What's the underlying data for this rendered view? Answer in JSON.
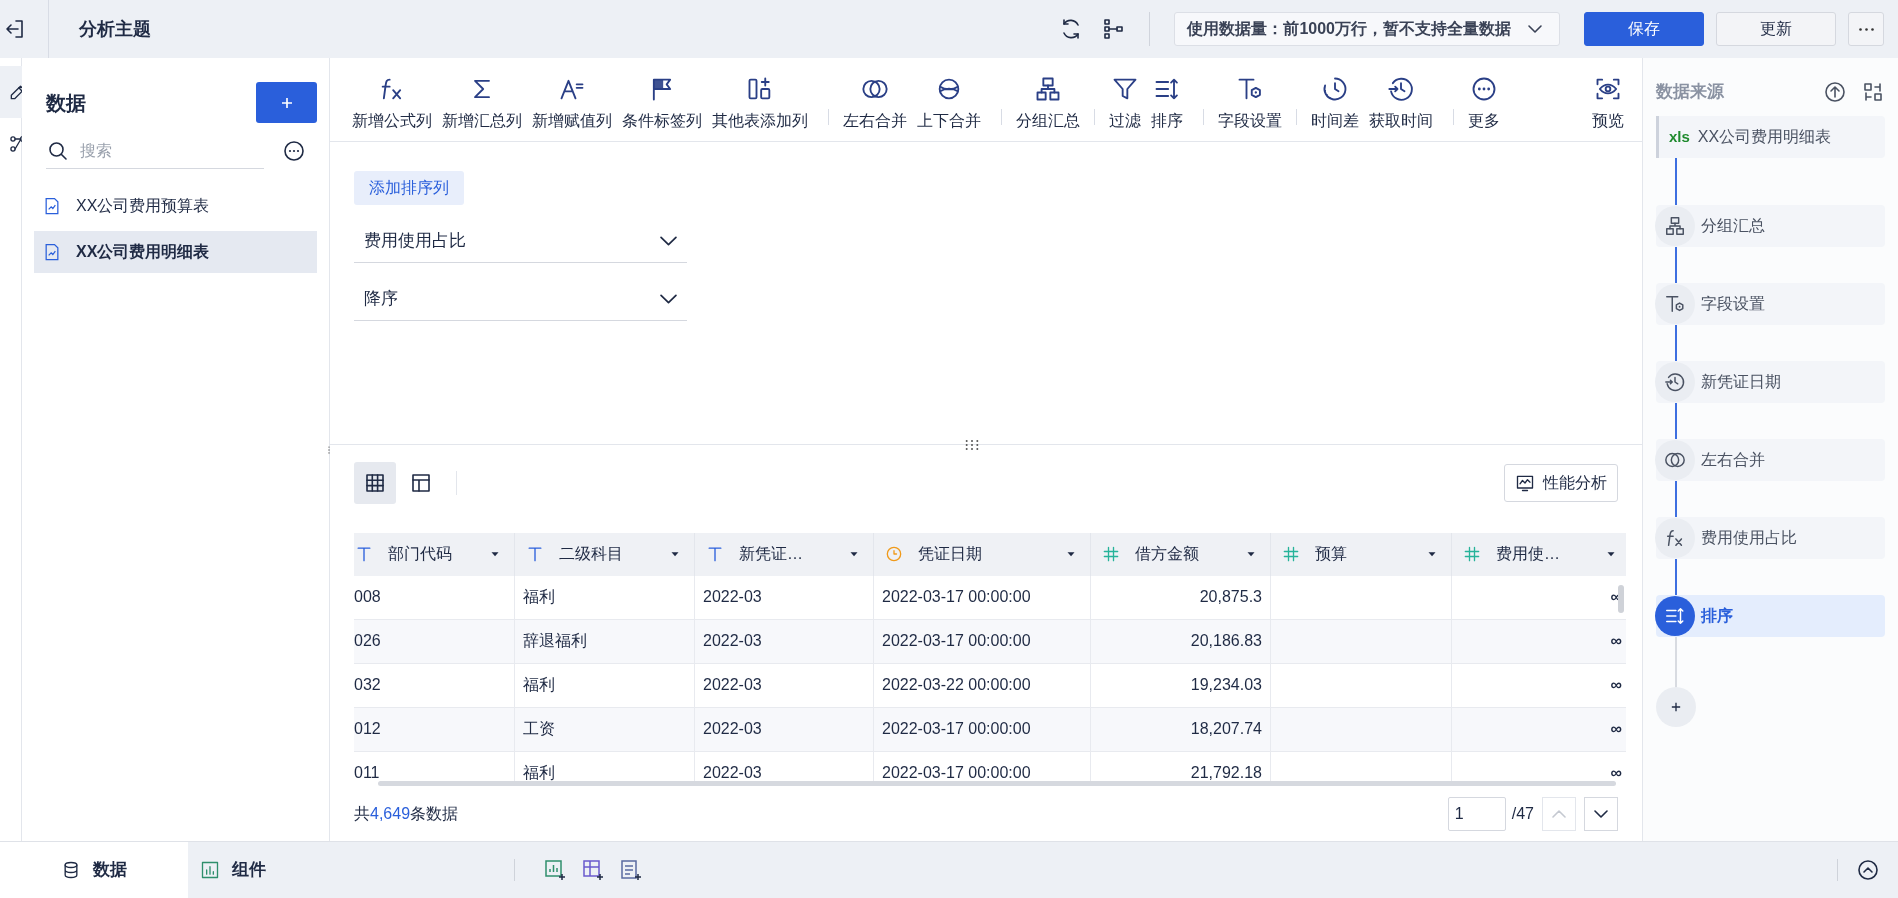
{
  "top_bar": {
    "title": "分析主题",
    "data_limit": "使用数据量：前1000万行，暂不支持全量数据",
    "buttons": [
      {
        "label": "保存",
        "kind": "primary"
      },
      {
        "label": "更新",
        "kind": "secondary"
      }
    ]
  },
  "side_rail": [
    {
      "kind": "edit",
      "selected": true
    },
    {
      "kind": "flow",
      "selected": false
    }
  ],
  "data_panel": {
    "title": "数据",
    "search": {
      "placeholder": "搜索"
    },
    "items": [
      {
        "label": "XX公司费用预算表",
        "selected": false
      },
      {
        "label": "XX公司费用明细表",
        "selected": true
      }
    ]
  },
  "toolbar": [
    [
      {
        "label": "新增公式列",
        "kind": "formula"
      },
      {
        "label": "新增汇总列",
        "kind": "sum"
      },
      {
        "label": "新增赋值列",
        "kind": "assign"
      },
      {
        "label": "条件标签列",
        "kind": "flag"
      },
      {
        "label": "其他表添加列",
        "kind": "addcol"
      }
    ],
    [
      {
        "label": "左右合并",
        "kind": "merge_lr"
      },
      {
        "label": "上下合并",
        "kind": "merge_ud"
      }
    ],
    [
      {
        "label": "分组汇总",
        "kind": "group"
      }
    ],
    [
      {
        "label": "过滤",
        "kind": "filter"
      },
      {
        "label": "排序",
        "kind": "sort"
      }
    ],
    [
      {
        "label": "字段设置",
        "kind": "field"
      }
    ],
    [
      {
        "label": "时间差",
        "kind": "timediff"
      },
      {
        "label": "获取时间",
        "kind": "gettime"
      }
    ],
    [
      {
        "label": "更多",
        "kind": "more"
      }
    ]
  ],
  "preview": {
    "label": "预览",
    "kind": "preview"
  },
  "sort_config": {
    "add_button": "添加排序列",
    "fields": [
      {
        "value": "费用使用占比"
      },
      {
        "value": "降序"
      }
    ]
  },
  "view_toggle": [
    {
      "kind": "grid",
      "selected": true
    },
    {
      "kind": "layout",
      "selected": false
    }
  ],
  "analysis_button": "性能分析",
  "table": {
    "columns": [
      {
        "label": "部门代码",
        "kind": "text"
      },
      {
        "label": "二级科目",
        "kind": "text"
      },
      {
        "label": "新凭证…",
        "kind": "text"
      },
      {
        "label": "凭证日期",
        "kind": "date"
      },
      {
        "label": "借方金额",
        "kind": "number"
      },
      {
        "label": "预算",
        "kind": "number"
      },
      {
        "label": "费用使…",
        "kind": "number"
      }
    ],
    "rows": [
      [
        "008",
        "福利",
        "2022-03",
        "2022-03-17 00:00:00",
        "20,875.3",
        "",
        "∞"
      ],
      [
        "026",
        "辞退福利",
        "2022-03",
        "2022-03-17 00:00:00",
        "20,186.83",
        "",
        "∞"
      ],
      [
        "032",
        "福利",
        "2022-03",
        "2022-03-22 00:00:00",
        "19,234.03",
        "",
        "∞"
      ],
      [
        "012",
        "工资",
        "2022-03",
        "2022-03-17 00:00:00",
        "18,207.74",
        "",
        "∞"
      ],
      [
        "011",
        "福利",
        "2022-03",
        "2022-03-17 00:00:00",
        "21,792.18",
        "",
        "∞"
      ]
    ]
  },
  "record_count": {
    "prefix": "共",
    "count": "4,649",
    "suffix": "条数据"
  },
  "pagination": {
    "page": "1",
    "total": "/47",
    "prev_disabled": true
  },
  "pipeline": {
    "title": "数据来源",
    "source": {
      "badge": "xls",
      "label": "XX公司费用明细表"
    },
    "steps": [
      {
        "label": "分组汇总",
        "kind": "group",
        "selected": false
      },
      {
        "label": "字段设置",
        "kind": "field",
        "selected": false
      },
      {
        "label": "新凭证日期",
        "kind": "gettime",
        "selected": false
      },
      {
        "label": "左右合并",
        "kind": "merge_lr",
        "selected": false
      },
      {
        "label": "费用使用占比",
        "kind": "formula",
        "selected": false
      },
      {
        "label": "排序",
        "kind": "sort",
        "selected": true
      }
    ]
  },
  "bottom_tabs": [
    {
      "label": "数据",
      "kind": "database",
      "selected": true
    },
    {
      "label": "组件",
      "kind": "chart",
      "selected": false
    }
  ]
}
